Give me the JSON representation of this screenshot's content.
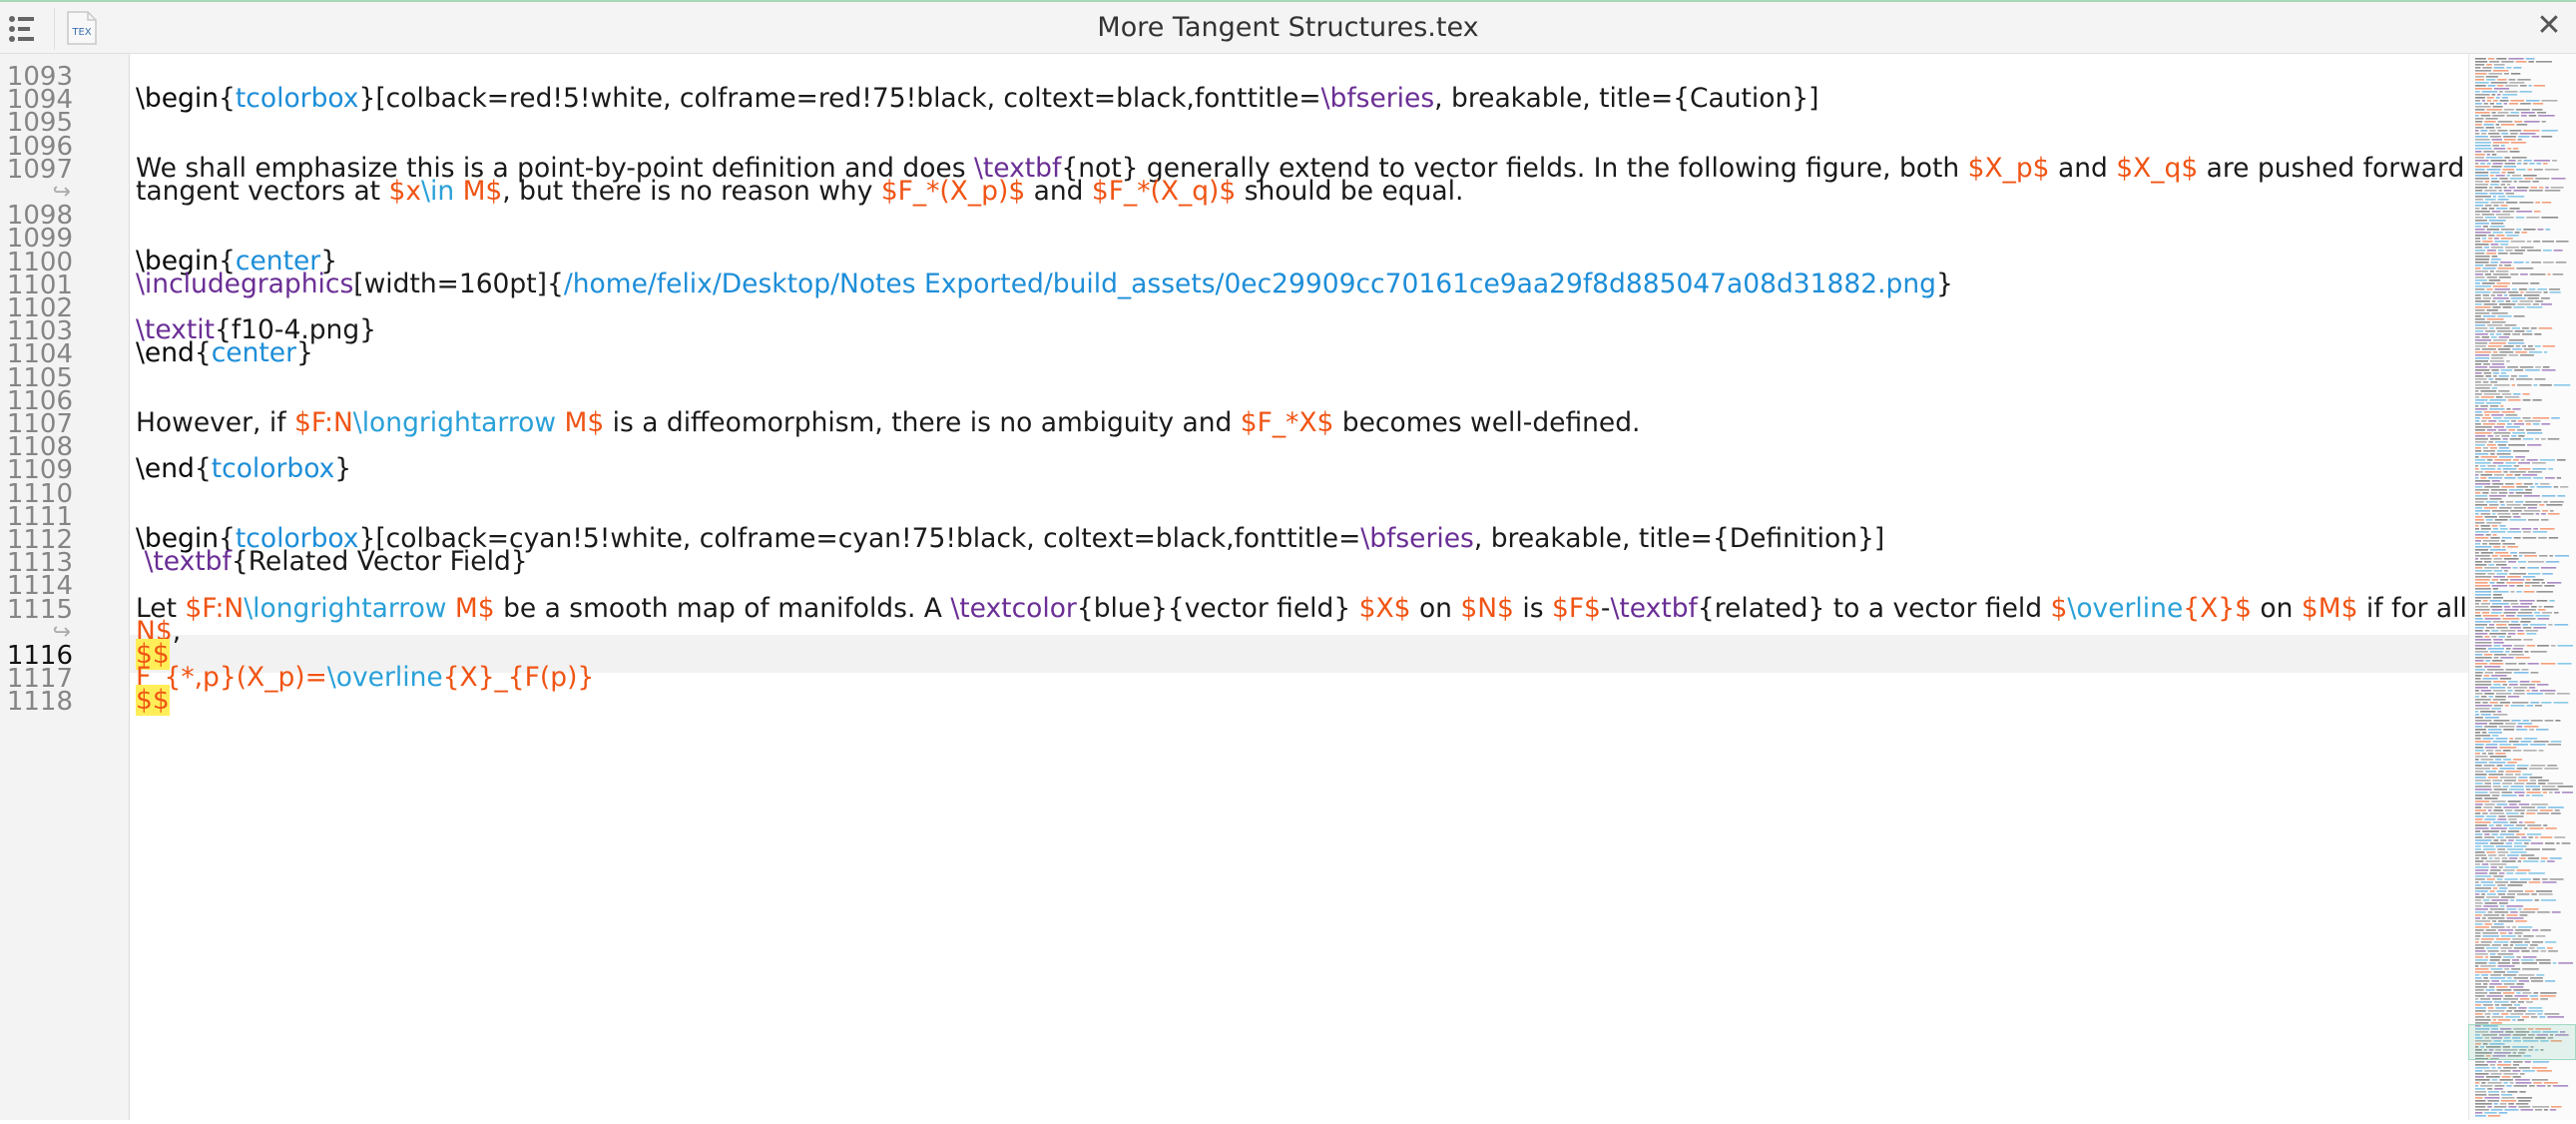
{
  "window": {
    "title": "More Tangent Structures.tex",
    "file_badge": "TEX",
    "menu_icon": "outline-list-icon",
    "close_icon": "close-icon",
    "accent_color": "#a8d8b8"
  },
  "gutter": {
    "line_numbers": [
      "1093",
      "1094",
      "1095",
      "1096",
      "1097",
      "1098",
      "1099",
      "1100",
      "1101",
      "1102",
      "1103",
      "1104",
      "1105",
      "1106",
      "1107",
      "1108",
      "1109",
      "1110",
      "1111",
      "1112",
      "1113",
      "1114",
      "1115",
      "1116",
      "1117",
      "1118"
    ],
    "current_line": "1116",
    "wrap_glyph": "↪"
  },
  "editor": {
    "colors": {
      "keyword": "#0a0a0a",
      "environment": "#1d8ed8",
      "command": "#6a2e95",
      "math": "#f05414",
      "math_command": "#2aa0d8",
      "math_delimiter_highlight": "#ffee58"
    },
    "lines": [
      {
        "t": ""
      },
      {
        "t": "\\begin{tcolorbox}[colback=red!5!white, colframe=red!75!black, coltext=black,fonttitle=\\bfseries, breakable, title={Caution}]"
      },
      {
        "t": ""
      },
      {
        "t": ""
      },
      {
        "t": "We shall emphasize this is a point-by-point definition and does \\textbf{not} generally extend to vector fields. In the following figure, both $X_p$ and $X_q$ are pushed forward to"
      },
      {
        "t": "tangent vectors at $x\\in M$, but there is no reason why $F_*(X_p)$ and $F_*(X_q)$ should be equal."
      },
      {
        "t": ""
      },
      {
        "t": ""
      },
      {
        "t": "\\begin{center}"
      },
      {
        "t": "\\includegraphics[width=160pt]{/home/felix/Desktop/Notes Exported/build_assets/0ec29909cc70161ce9aa29f8d885047a08d31882.png}"
      },
      {
        "t": ""
      },
      {
        "t": "\\textit{f10-4.png}"
      },
      {
        "t": "\\end{center}"
      },
      {
        "t": ""
      },
      {
        "t": ""
      },
      {
        "t": "However, if $F:N\\longrightarrow M$ is a diffeomorphism, there is no ambiguity and $F_*X$ becomes well-defined."
      },
      {
        "t": ""
      },
      {
        "t": "\\end{tcolorbox}"
      },
      {
        "t": ""
      },
      {
        "t": ""
      },
      {
        "t": "\\begin{tcolorbox}[colback=cyan!5!white, colframe=cyan!75!black, coltext=black,fonttitle=\\bfseries, breakable, title={Definition}]"
      },
      {
        "t": " \\textbf{Related Vector Field}"
      },
      {
        "t": ""
      },
      {
        "t": "Let $F:N\\longrightarrow M$ be a smooth map of manifolds. A \\textcolor{blue}{vector field} $X$ on $N$ is $F$-\\textbf{related} to a vector field $\\overline{X}$ on $M$ if for all $p\\in"
      },
      {
        "t": "N$,"
      },
      {
        "t": "$$"
      },
      {
        "t": "F_{*,p}(X_p)=\\overline{X}_{F(p)}"
      },
      {
        "t": "$$"
      }
    ]
  }
}
